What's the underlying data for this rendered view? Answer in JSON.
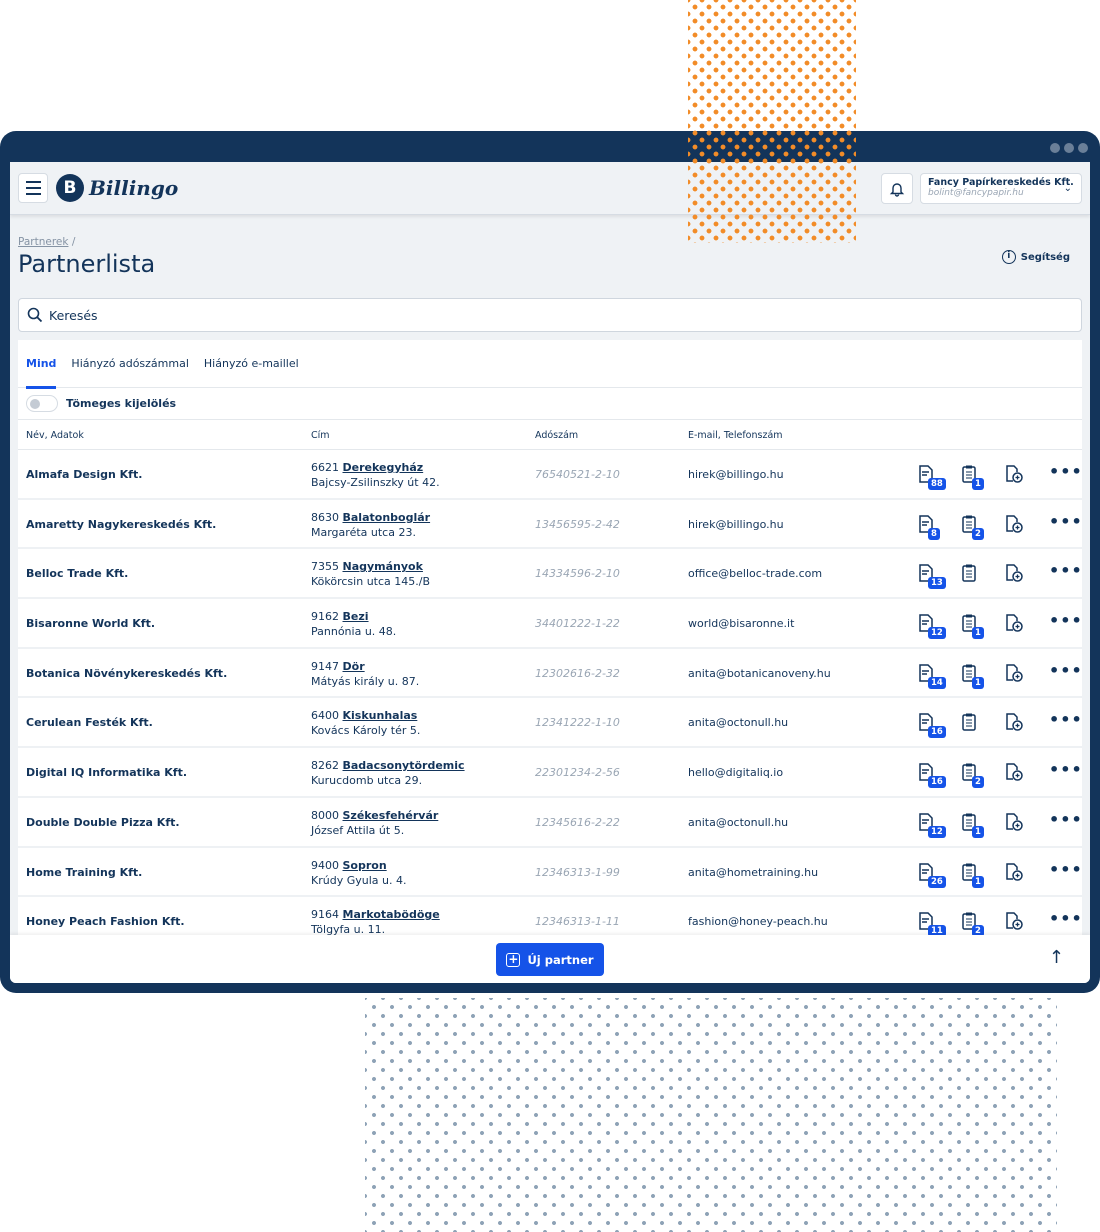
{
  "app": {
    "logo_text": "Billingo",
    "logo_letter": "B"
  },
  "account": {
    "name": "Fancy Papírkereskedés Kft.",
    "email": "bolint@fancypapir.hu"
  },
  "breadcrumb": {
    "parent": "Partnerek",
    "sep": "/"
  },
  "page": {
    "title": "Partnerlista",
    "help": "Segítség"
  },
  "search": {
    "placeholder": "Keresés"
  },
  "tabs": [
    {
      "label": "Mind",
      "active": true
    },
    {
      "label": "Hiányzó adószámmal"
    },
    {
      "label": "Hiányzó e-maillel"
    }
  ],
  "bulk_select": {
    "label": "Tömeges kijelölés",
    "on": false
  },
  "columns": [
    "Név, Adatok",
    "Cím",
    "Adószám",
    "E-mail, Telefonszám"
  ],
  "rows": [
    {
      "name": "Almafa Design Kft.",
      "zip": "6621",
      "city": "Derekegyház",
      "street": "Bajcsy-Zsilinszky út 42.",
      "tax": "76540521-2-10",
      "email": "hirek@billingo.hu",
      "invoices": "88",
      "drafts": "1"
    },
    {
      "name": "Amaretty Nagykereskedés Kft.",
      "zip": "8630",
      "city": "Balatonboglár",
      "street": "Margaréta utca 23.",
      "tax": "13456595-2-42",
      "email": "hirek@billingo.hu",
      "invoices": "8",
      "drafts": "2"
    },
    {
      "name": "Belloc Trade Kft.",
      "zip": "7355",
      "city": "Nagymányok",
      "street": "Kökörcsin utca 145./B",
      "tax": "14334596-2-10",
      "email": "office@belloc-trade.com",
      "invoices": "13",
      "drafts": ""
    },
    {
      "name": "Bisaronne World Kft.",
      "zip": "9162",
      "city": "Bezi",
      "street": "Pannónia u. 48.",
      "tax": "34401222-1-22",
      "email": "world@bisaronne.it",
      "invoices": "12",
      "drafts": "1"
    },
    {
      "name": "Botanica Növénykereskedés Kft.",
      "zip": "9147",
      "city": "Dör",
      "street": "Mátyás király u. 87.",
      "tax": "12302616-2-32",
      "email": "anita@botanicanoveny.hu",
      "invoices": "14",
      "drafts": "1"
    },
    {
      "name": "Cerulean Festék Kft.",
      "zip": "6400",
      "city": "Kiskunhalas",
      "street": "Kovács Károly tér 5.",
      "tax": "12341222-1-10",
      "email": "anita@octonull.hu",
      "invoices": "16",
      "drafts": ""
    },
    {
      "name": "Digital IQ Informatika Kft.",
      "zip": "8262",
      "city": "Badacsonytördemic",
      "street": "Kurucdomb utca 29.",
      "tax": "22301234-2-56",
      "email": "hello@digitaliq.io",
      "invoices": "16",
      "drafts": "2"
    },
    {
      "name": "Double Double Pizza Kft.",
      "zip": "8000",
      "city": "Székesfehérvár",
      "street": "József Attila út 5.",
      "tax": "12345616-2-22",
      "email": "anita@octonull.hu",
      "invoices": "12",
      "drafts": "1"
    },
    {
      "name": "Home Training Kft.",
      "zip": "9400",
      "city": "Sopron",
      "street": "Krúdy Gyula u. 4.",
      "tax": "12346313-1-99",
      "email": "anita@hometraining.hu",
      "invoices": "26",
      "drafts": "1"
    },
    {
      "name": "Honey Peach Fashion Kft.",
      "zip": "9164",
      "city": "Markotabödöge",
      "street": "Tölgyfa u. 11.",
      "tax": "12346313-1-11",
      "email": "fashion@honey-peach.hu",
      "invoices": "11",
      "drafts": "2"
    }
  ],
  "footer": {
    "new_partner": "Új partner"
  },
  "colors": {
    "navy": "#13345a",
    "accent": "#1553e8",
    "orange": "#f28c28",
    "grey_dots": "#8ea2b6"
  },
  "icons": [
    "menu-icon",
    "bell-icon",
    "chevron-down-icon",
    "info-icon",
    "search-icon",
    "invoice-icon",
    "clipboard-icon",
    "new-document-icon",
    "more-icon",
    "arrow-up-icon",
    "plus-icon"
  ]
}
